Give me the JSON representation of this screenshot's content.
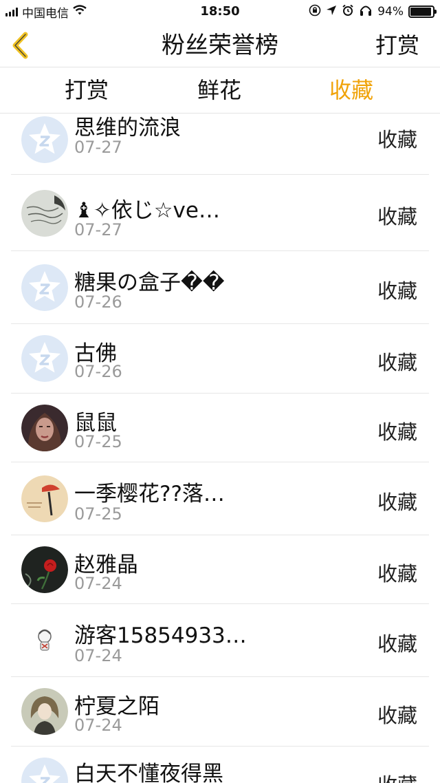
{
  "status_bar": {
    "carrier": "中国电信",
    "time": "18:50",
    "battery": "94%",
    "battery_level": 0.94
  },
  "nav": {
    "title": "粉丝荣誉榜",
    "right_action": "打赏",
    "back_icon": "chevron-left-icon",
    "accent_color": "#f0a30a"
  },
  "tabs": [
    {
      "label": "打赏",
      "active": false
    },
    {
      "label": "鲜花",
      "active": false
    },
    {
      "label": "收藏",
      "active": true
    }
  ],
  "list": [
    {
      "name": "思维的流浪",
      "date": "07-27",
      "action": "收藏",
      "avatar": "default-star-avatar"
    },
    {
      "name": "♝✧依じ☆ve…",
      "date": "07-27",
      "action": "收藏",
      "avatar": "handwriting-avatar"
    },
    {
      "name": "糖果の盒子��",
      "date": "07-26",
      "action": "收藏",
      "avatar": "default-star-avatar"
    },
    {
      "name": "古佛",
      "date": "07-26",
      "action": "收藏",
      "avatar": "default-star-avatar"
    },
    {
      "name": "鼠鼠",
      "date": "07-25",
      "action": "收藏",
      "avatar": "portrait-avatar"
    },
    {
      "name": "一季樱花??落…",
      "date": "07-25",
      "action": "收藏",
      "avatar": "cartoon-hat-avatar"
    },
    {
      "name": "赵雅晶",
      "date": "07-24",
      "action": "收藏",
      "avatar": "rose-avatar"
    },
    {
      "name": "游客15854933…",
      "date": "07-24",
      "action": "收藏",
      "avatar": "cartoon-small-avatar"
    },
    {
      "name": "柠夏之陌",
      "date": "07-24",
      "action": "收藏",
      "avatar": "anime-girl-avatar"
    },
    {
      "name": "白天不懂夜得黑",
      "date": "",
      "action": "收藏",
      "avatar": "default-star-avatar"
    }
  ]
}
